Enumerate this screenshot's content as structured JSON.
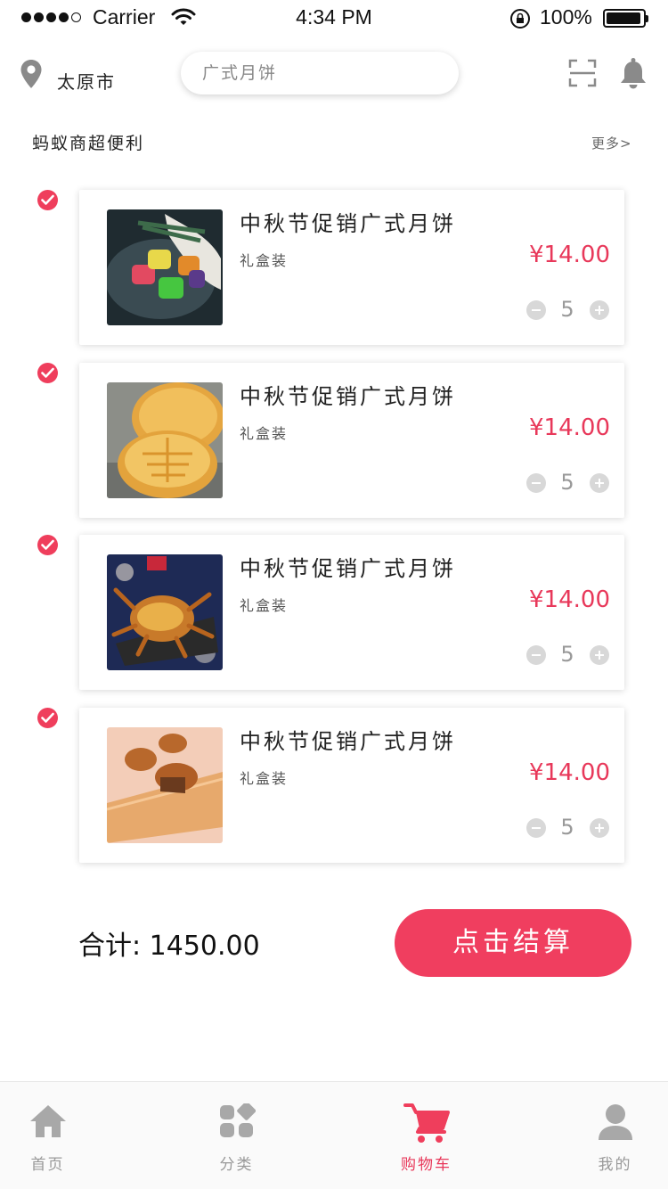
{
  "status_bar": {
    "carrier": "Carrier",
    "time": "4:34 PM",
    "battery": "100%"
  },
  "header": {
    "city": "太原市",
    "search_placeholder": "广式月饼",
    "location_icon": "location-pin-icon",
    "scan_icon": "scan-icon",
    "bell_icon": "bell-icon"
  },
  "store": {
    "name": "蚂蚁商超便利",
    "more": "更多>"
  },
  "items": [
    {
      "title": "中秋节促销广式月饼",
      "subtitle": "礼盒装",
      "price": "¥14.00",
      "quantity": "5",
      "checked": true,
      "image": "colorful-mooncakes-photo"
    },
    {
      "title": "中秋节促销广式月饼",
      "subtitle": "礼盒装",
      "price": "¥14.00",
      "quantity": "5",
      "checked": true,
      "image": "golden-mooncakes-photo"
    },
    {
      "title": "中秋节促销广式月饼",
      "subtitle": "礼盒装",
      "price": "¥14.00",
      "quantity": "5",
      "checked": true,
      "image": "hairy-crab-photo"
    },
    {
      "title": "中秋节促销广式月饼",
      "subtitle": "礼盒装",
      "price": "¥14.00",
      "quantity": "5",
      "checked": true,
      "image": "mooncakes-on-board-photo"
    }
  ],
  "summary": {
    "total_label": "合计: 1450.00",
    "checkout_label": "点击结算"
  },
  "tabbar": {
    "tabs": [
      {
        "label": "首页",
        "icon": "home-icon",
        "active": false
      },
      {
        "label": "分类",
        "icon": "category-icon",
        "active": false
      },
      {
        "label": "购物车",
        "icon": "cart-icon",
        "active": true
      },
      {
        "label": "我的",
        "icon": "profile-icon",
        "active": false
      }
    ]
  },
  "colors": {
    "accent": "#f03e5f",
    "price": "#e8385a",
    "inactive_tab": "#999999"
  }
}
